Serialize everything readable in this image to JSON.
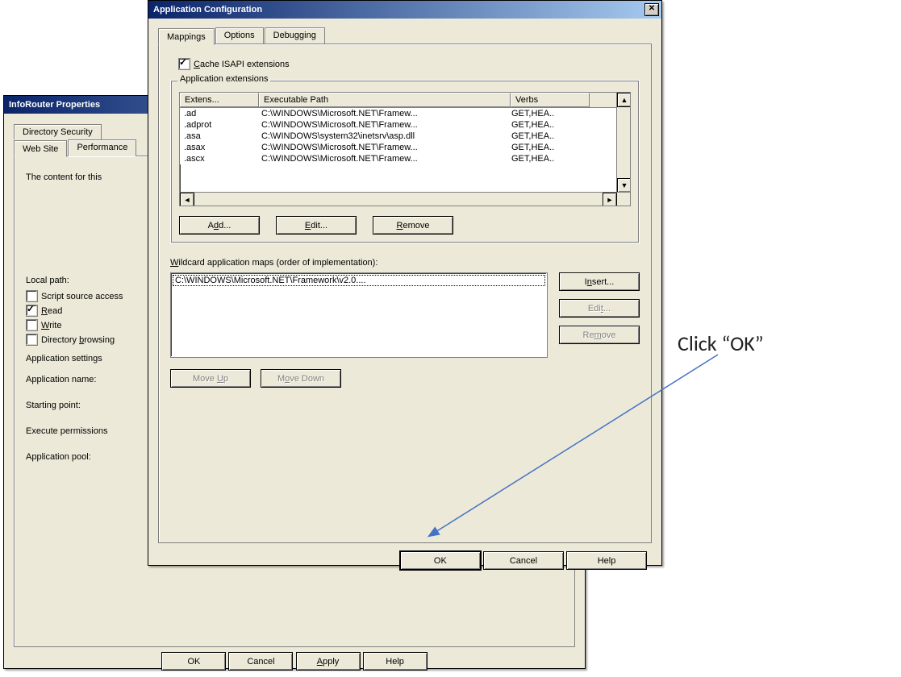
{
  "back_dialog": {
    "title": "InfoRouter Properties",
    "tabs": {
      "dir_security": "Directory Security",
      "web_site": "Web Site",
      "perf": "Performance"
    },
    "content_line": "The content for this",
    "local_path_label": "Local path:",
    "chk_script": "Script source access",
    "chk_read": "Read",
    "chk_write": "Write",
    "chk_dirbrowse": "Directory browsing",
    "app_settings": "Application settings",
    "app_name": "Application name:",
    "starting_point": "Starting point:",
    "exec_perm": "Execute permissions",
    "app_pool": "Application pool:",
    "btn_ok": "OK",
    "btn_cancel": "Cancel",
    "btn_apply": "Apply",
    "btn_help": "Help"
  },
  "front_dialog": {
    "title": "Application Configuration",
    "tabs": {
      "mappings": "Mappings",
      "options": "Options",
      "debugging": "Debugging"
    },
    "chk_cache": "Cache ISAPI extensions",
    "group_appext": "Application extensions",
    "table": {
      "head_ext": "Extens...",
      "head_path": "Executable Path",
      "head_verbs": "Verbs",
      "rows": [
        {
          "ext": ".ad",
          "path": "C:\\WINDOWS\\Microsoft.NET\\Framew...",
          "verbs": "GET,HEA.."
        },
        {
          "ext": ".adprot",
          "path": "C:\\WINDOWS\\Microsoft.NET\\Framew...",
          "verbs": "GET,HEA.."
        },
        {
          "ext": ".asa",
          "path": "C:\\WINDOWS\\system32\\inetsrv\\asp.dll",
          "verbs": "GET,HEA.."
        },
        {
          "ext": ".asax",
          "path": "C:\\WINDOWS\\Microsoft.NET\\Framew...",
          "verbs": "GET,HEA.."
        },
        {
          "ext": ".ascx",
          "path": "C:\\WINDOWS\\Microsoft.NET\\Framew...",
          "verbs": "GET,HEA.."
        }
      ]
    },
    "btn_add": "Add...",
    "btn_edit": "Edit...",
    "btn_remove": "Remove",
    "wildcard_label": "Wildcard application maps (order of implementation):",
    "wildcard_item": "C:\\WINDOWS\\Microsoft.NET\\Framework\\v2.0....",
    "btn_insert": "Insert...",
    "btn_edit2": "Edit...",
    "btn_remove2": "Remove",
    "btn_moveup": "Move Up",
    "btn_movedown": "Move Down",
    "btn_ok": "OK",
    "btn_cancel": "Cancel",
    "btn_help": "Help"
  },
  "annotation": {
    "text": "Click “OK”"
  }
}
